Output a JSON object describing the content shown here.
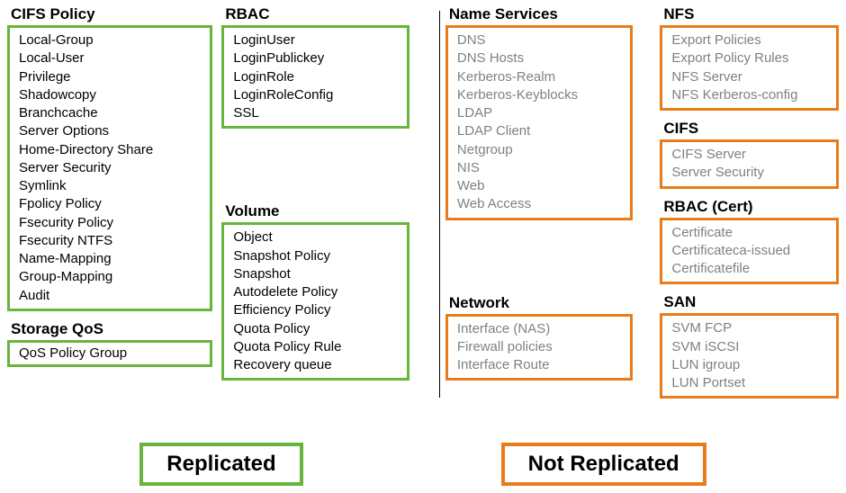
{
  "replicated": {
    "legend": "Replicated",
    "groups": [
      {
        "title": "CIFS Policy",
        "items": [
          "Local-Group",
          "Local-User",
          "Privilege",
          "Shadowcopy",
          "Branchcache",
          "Server Options",
          "Home-Directory Share",
          "Server Security",
          "Symlink",
          "Fpolicy Policy",
          "Fsecurity Policy",
          "Fsecurity NTFS",
          "Name-Mapping",
          "Group-Mapping",
          "Audit"
        ]
      },
      {
        "title": "Storage QoS",
        "items": [
          "QoS Policy Group"
        ]
      },
      {
        "title": "RBAC",
        "items": [
          "LoginUser",
          "LoginPublickey",
          "LoginRole",
          "LoginRoleConfig",
          "SSL"
        ]
      },
      {
        "title": "Volume",
        "items": [
          "Object",
          "Snapshot Policy",
          "Snapshot",
          "Autodelete Policy",
          "Efficiency Policy",
          "Quota Policy",
          "Quota Policy Rule",
          "Recovery queue"
        ]
      }
    ]
  },
  "not_replicated": {
    "legend": "Not Replicated",
    "groups": [
      {
        "title": "Name Services",
        "items": [
          "DNS",
          "DNS Hosts",
          "Kerberos-Realm",
          "Kerberos-Keyblocks",
          "LDAP",
          "LDAP Client",
          "Netgroup",
          "NIS",
          "Web",
          "Web Access"
        ]
      },
      {
        "title": "Network",
        "items": [
          "Interface  (NAS)",
          "Firewall policies",
          "Interface  Route"
        ]
      },
      {
        "title": "NFS",
        "items": [
          "Export Policies",
          "Export Policy Rules",
          "NFS Server",
          "NFS Kerberos-config"
        ]
      },
      {
        "title": "CIFS",
        "items": [
          "CIFS Server",
          "Server Security"
        ]
      },
      {
        "title": "RBAC (Cert)",
        "items": [
          "Certificate",
          "Certificateca-issued",
          "Certificatefile"
        ]
      },
      {
        "title": "SAN",
        "items": [
          "SVM FCP",
          "SVM iSCSI",
          "LUN igroup",
          "LUN Portset"
        ]
      }
    ]
  }
}
